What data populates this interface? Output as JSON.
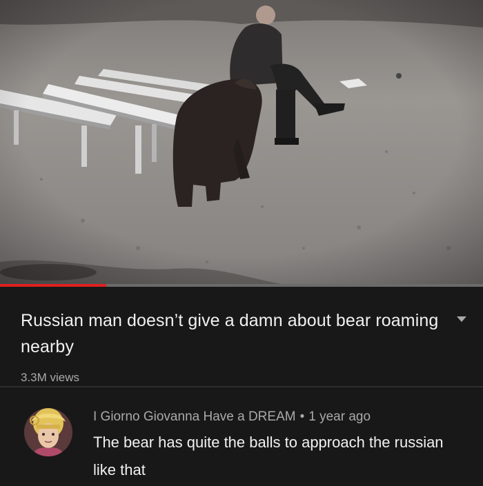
{
  "video": {
    "progress_fraction": 0.22
  },
  "info": {
    "title": "Russian man doesn’t give a damn about bear roaming nearby",
    "views": "3.3M views",
    "expand_icon": "chevron-down-icon"
  },
  "comment": {
    "author": "I Giorno Giovanna Have a DREAM",
    "separator": "•",
    "time": "1 year ago",
    "text": "The bear has quite the balls to approach the russian like that"
  },
  "colors": {
    "background": "#181818",
    "progress": "#e02020",
    "text_primary": "#f1f1f1",
    "text_secondary": "#aaaaaa"
  }
}
